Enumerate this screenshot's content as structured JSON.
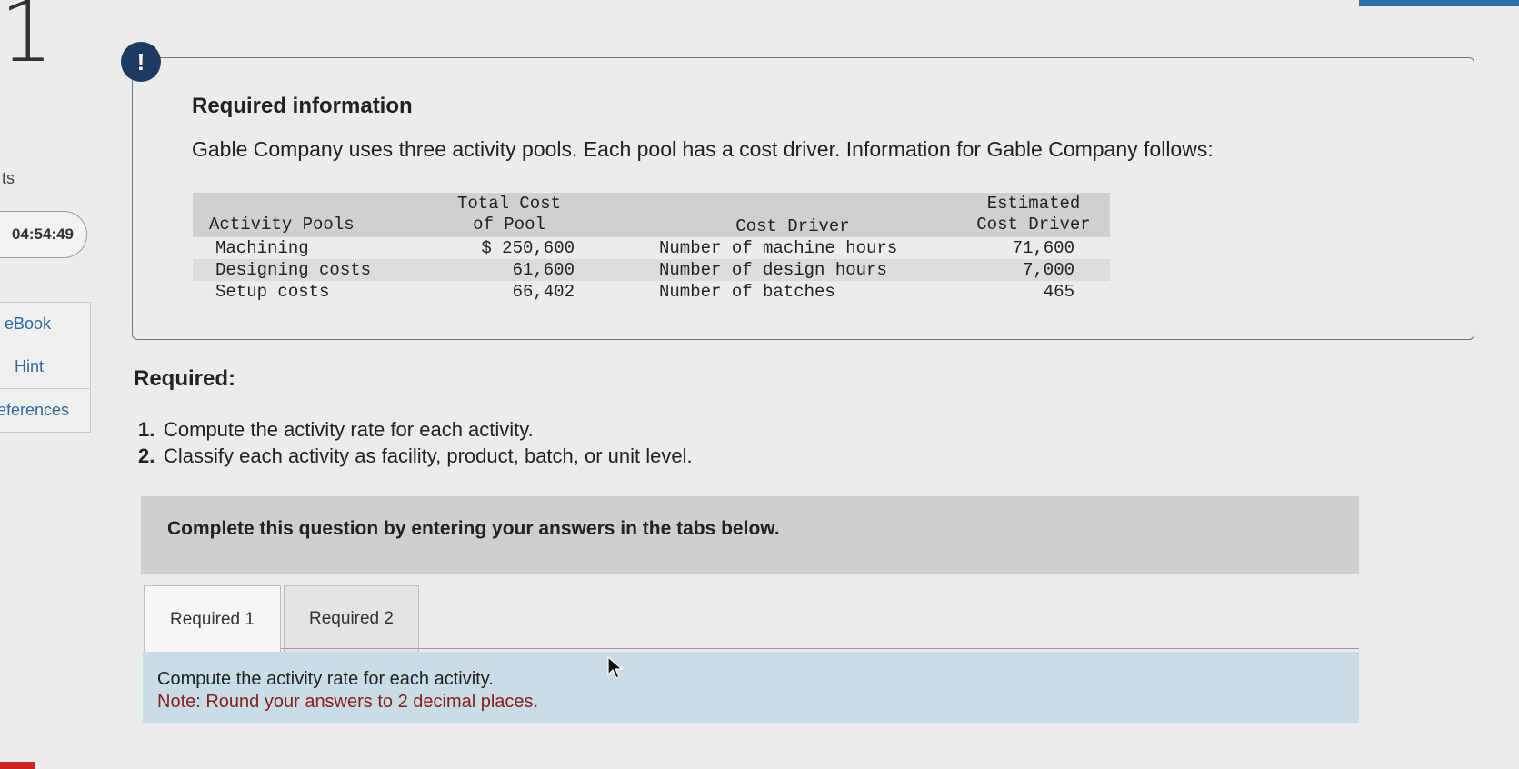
{
  "question_number": "1",
  "sidebar": {
    "partial_label": "ts",
    "timer": "04:54:49",
    "tools": [
      {
        "label": "eBook"
      },
      {
        "label": "Hint"
      },
      {
        "label": "eferences"
      }
    ]
  },
  "info": {
    "icon_text": "!",
    "title": "Required information",
    "text": "Gable Company uses three activity pools. Each pool has a cost driver. Information for Gable Company follows:",
    "table": {
      "headers": {
        "activity_pools": "Activity Pools",
        "total_cost_l1": "Total Cost",
        "total_cost_l2": "of Pool",
        "cost_driver": "Cost Driver",
        "estimated_l1": "Estimated",
        "estimated_l2": "Cost Driver"
      },
      "rows": [
        {
          "pool": "Machining",
          "cost": "$ 250,600",
          "driver": "Number of machine hours",
          "estimate": "71,600"
        },
        {
          "pool": "Designing costs",
          "cost": "61,600",
          "driver": "Number of design hours",
          "estimate": "7,000"
        },
        {
          "pool": "Setup costs",
          "cost": "66,402",
          "driver": "Number of batches",
          "estimate": "465"
        }
      ]
    }
  },
  "required": {
    "heading": "Required:",
    "items": [
      {
        "num": "1.",
        "text": "Compute the activity rate for each activity."
      },
      {
        "num": "2.",
        "text": "Classify each activity as facility, product, batch, or unit level."
      }
    ]
  },
  "banner": {
    "text": "Complete this question by entering your answers in the tabs below."
  },
  "tabs": [
    {
      "label": "Required 1"
    },
    {
      "label": "Required 2"
    }
  ],
  "panel": {
    "instruction": "Compute the activity rate for each activity.",
    "note": "Note: Round your answers to 2 decimal places."
  },
  "colors": {
    "accent": "#2e6fb0",
    "alert_icon_bg": "#1e3a63",
    "panel_bg": "#c9dde7",
    "note_text": "#8a1c1c"
  }
}
